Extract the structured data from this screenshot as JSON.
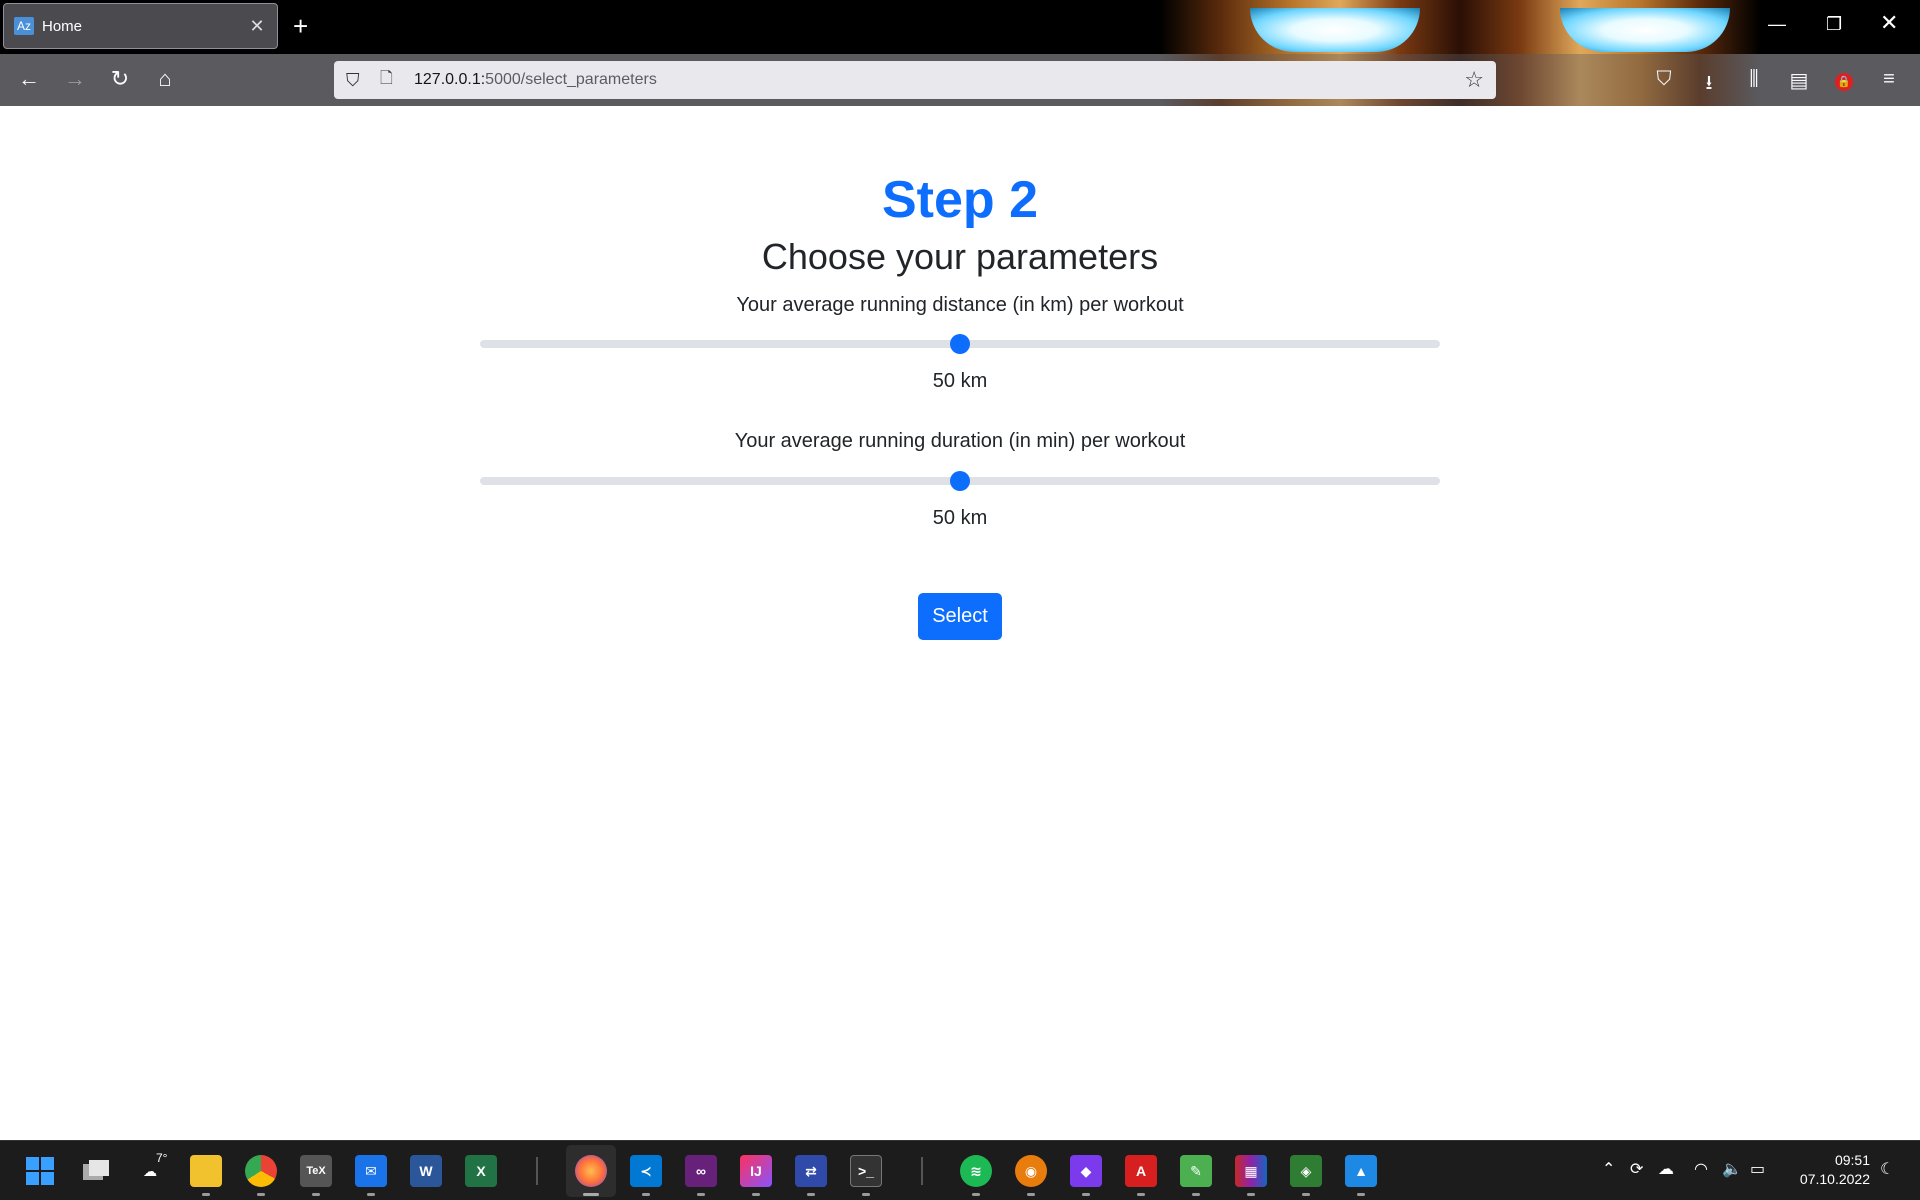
{
  "browser": {
    "tab_title": "Home",
    "tab_favicon": "Az",
    "url_host": "127.0.0.1:",
    "url_path": "5000/select_parameters"
  },
  "page": {
    "step_title": "Step 2",
    "subtitle": "Choose your parameters",
    "distance": {
      "label": "Your average running distance (in km) per workout",
      "value_text": "50 km",
      "slider_fraction": 0.5
    },
    "duration": {
      "label": "Your average running duration (in min) per workout",
      "value_text": "50 km",
      "slider_fraction": 0.5
    },
    "button_label": "Select"
  },
  "taskbar": {
    "weather_temp": "7°",
    "time": "09:51",
    "date": "07.10.2022"
  },
  "colors": {
    "accent": "#0d6efd",
    "track": "#dee2e6",
    "text": "#212529"
  }
}
